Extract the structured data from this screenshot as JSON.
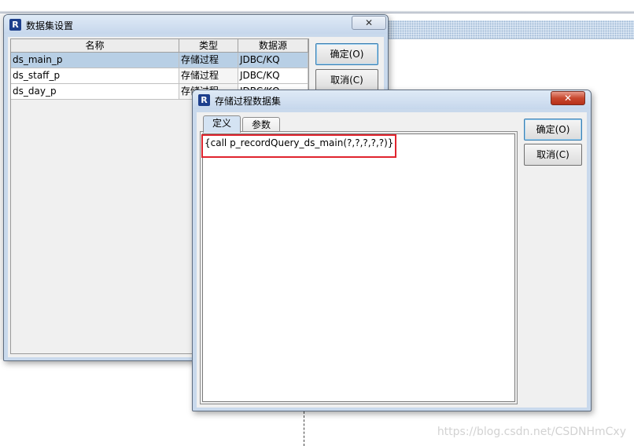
{
  "dataset_window": {
    "title": "数据集设置",
    "close_glyph": "✕",
    "table": {
      "headers": [
        "名称",
        "类型",
        "数据源"
      ],
      "rows": [
        {
          "name": "ds_main_p",
          "type": "存储过程",
          "source": "JDBC/KQ",
          "selected": true
        },
        {
          "name": "ds_staff_p",
          "type": "存储过程",
          "source": "JDBC/KQ",
          "selected": false
        },
        {
          "name": "ds_day_p",
          "type": "存储过程",
          "source": "JDBC/KQ",
          "selected": false
        }
      ]
    },
    "ok_label": "确定(O)",
    "cancel_label": "取消(C)"
  },
  "proc_dialog": {
    "title": "存储过程数据集",
    "close_glyph": "✕",
    "tabs": [
      {
        "label": "定义",
        "active": true
      },
      {
        "label": "参数",
        "active": false
      }
    ],
    "sql": "{call p_recordQuery_ds_main(?,?,?,?,?)}",
    "ok_label": "确定(O)",
    "cancel_label": "取消(C)"
  },
  "app_icon_letter": "R",
  "watermark": "https://blog.csdn.net/CSDNHmCxy",
  "colors": {
    "selection": "#b8cfe5",
    "highlight": "#e0242e",
    "window_frame": "#c9d9ec",
    "close_red": "#c8482f"
  }
}
